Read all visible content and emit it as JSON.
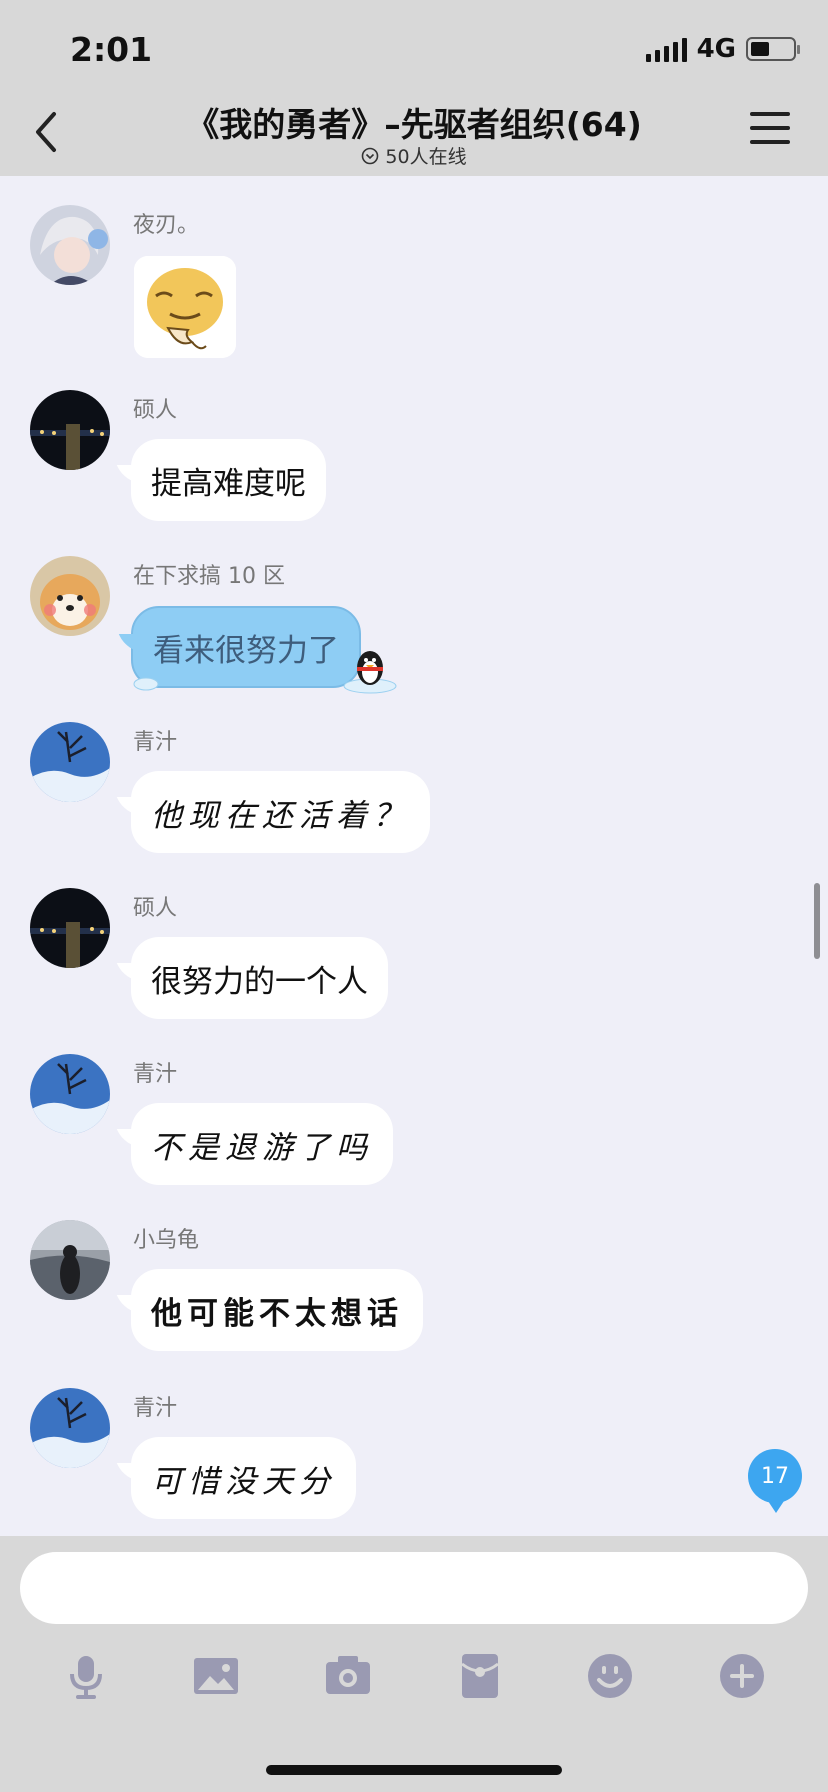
{
  "status_bar": {
    "time": "2:01",
    "network": "4G"
  },
  "header": {
    "title": "《我的勇者》–先驱者组织(64)",
    "online": "50人在线"
  },
  "messages": [
    {
      "sender": "夜刃。",
      "type": "sticker"
    },
    {
      "sender": "硕人",
      "text": "提高难度呢"
    },
    {
      "sender": "在下求搞 10 区",
      "text": "看来很努力了"
    },
    {
      "sender": "青汁",
      "text": "他现在还活着？"
    },
    {
      "sender": "硕人",
      "text": "很努力的一个人"
    },
    {
      "sender": "青汁",
      "text": "不是退游了吗"
    },
    {
      "sender": "小乌龟",
      "text": "他可能不太想话"
    },
    {
      "sender": "青汁",
      "text": "可惜没天分"
    }
  ],
  "unread_badge": "17",
  "input": {
    "placeholder": ""
  },
  "toolbar_icons": [
    "microphone-icon",
    "image-icon",
    "camera-icon",
    "red-packet-icon",
    "emoji-icon",
    "plus-icon"
  ],
  "colors": {
    "background": "#efeff8",
    "bar": "#d8d8d8",
    "accent": "#3da6f0",
    "blue_bubble": "#8ecdf4",
    "icon": "#9a9ab2"
  }
}
